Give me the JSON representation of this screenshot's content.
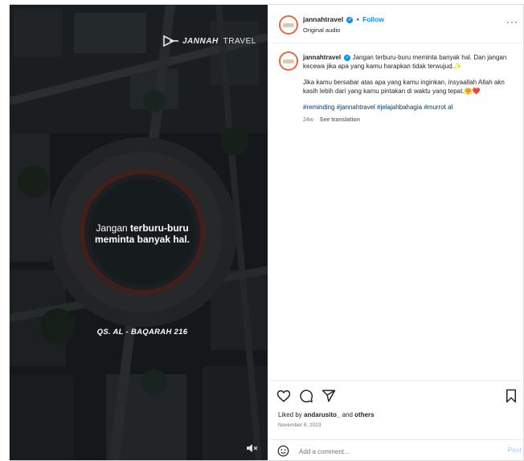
{
  "media": {
    "brand_bold": "JANNAH",
    "brand_light": "TRAVEL",
    "quote_light": "Jangan ",
    "quote_bold_1": "terburu-buru",
    "quote_bold_2": "meminta banyak hal.",
    "reference": "QS. AL - BAQARAH 216"
  },
  "header": {
    "username": "jannahtravel",
    "separator": "•",
    "follow_label": "Follow",
    "audio": "Original audio",
    "more": "···"
  },
  "caption": {
    "username": "jannahtravel",
    "line1": "Jangan terburu-buru meminta banyak hal. Dan jangan kecewa jika apa yang kamu harapkan tidak terwujud.✨",
    "line2": "Jika kamu bersabar atas apa yang kamu inginkan, insyaallah Allah akn kasih lebih dari yang kamu pintakan di waktu yang tepat.🤗❤️",
    "hashtags": "#reminding #jannahtravel #jelajahbahagia #murrot al",
    "age": "24w",
    "translate": "See translation"
  },
  "engagement": {
    "liked_prefix": "Liked by ",
    "liked_user": "andarusito_",
    "liked_mid": " and ",
    "liked_others": "others",
    "date": "November 8, 2023"
  },
  "comment": {
    "placeholder": "Add a comment...",
    "post_label": "Post"
  },
  "colors": {
    "accent_blue": "#0095f6",
    "hashtag": "#00376b"
  }
}
